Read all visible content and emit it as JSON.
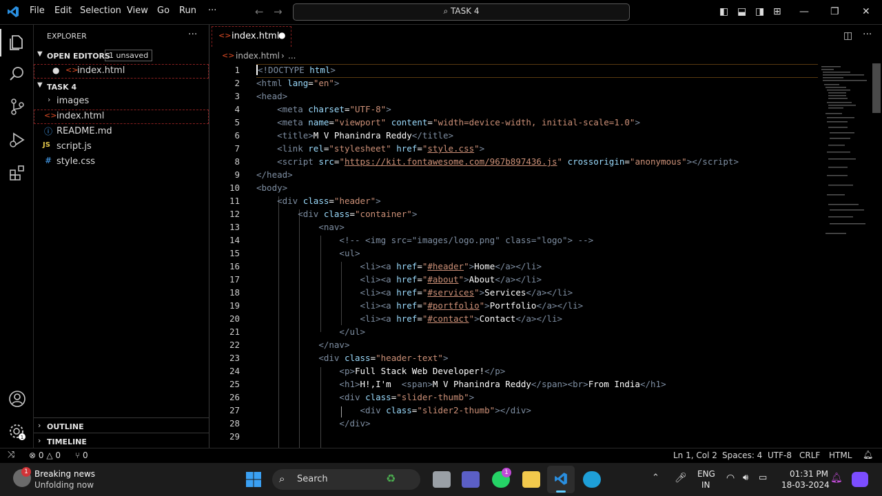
{
  "titlebar": {
    "menus": [
      "File",
      "Edit",
      "Selection",
      "View",
      "Go",
      "Run",
      "···"
    ],
    "command_center": "TASK 4"
  },
  "sidebar": {
    "title": "EXPLORER",
    "open_editors_label": "OPEN EDITORS",
    "unsaved_badge": "1 unsaved",
    "open_file": "index.html",
    "folder_label": "TASK 4",
    "files": [
      {
        "name": "images",
        "icon": "chevron-right-icon"
      },
      {
        "name": "index.html",
        "icon": "html-file-icon"
      },
      {
        "name": "README.md",
        "icon": "info-icon"
      },
      {
        "name": "script.js",
        "icon": "js-file-icon"
      },
      {
        "name": "style.css",
        "icon": "css-file-icon"
      }
    ],
    "outline_label": "OUTLINE",
    "timeline_label": "TIMELINE"
  },
  "editor": {
    "tab_label": "index.html",
    "breadcrumb_file": "index.html",
    "breadcrumb_more": "...",
    "line_numbers": [
      "1",
      "2",
      "3",
      "4",
      "5",
      "6",
      "7",
      "8",
      "9",
      "10",
      "11",
      "12",
      "13",
      "14",
      "15",
      "16",
      "17",
      "18",
      "19",
      "20",
      "21",
      "22",
      "23",
      "24",
      "25",
      "26",
      "27",
      "28",
      "29"
    ]
  },
  "statusbar": {
    "errors": "0",
    "warnings": "0",
    "ports": "0",
    "cursor": "Ln 1, Col 2",
    "spaces": "Spaces: 4",
    "encoding": "UTF-8",
    "eol": "CRLF",
    "language": "HTML"
  },
  "taskbar": {
    "news_title": "Breaking news",
    "news_sub": "Unfolding now",
    "search": "Search",
    "lang_top": "ENG",
    "lang_bottom": "IN",
    "time": "01:31 PM",
    "date": "18-03-2024",
    "notification_count": "1"
  },
  "colors": {
    "accent": "#0078d4",
    "tag": "#7f8fa3",
    "attr": "#9cdcfe",
    "string": "#ce9178",
    "comment": "#6a9955"
  }
}
